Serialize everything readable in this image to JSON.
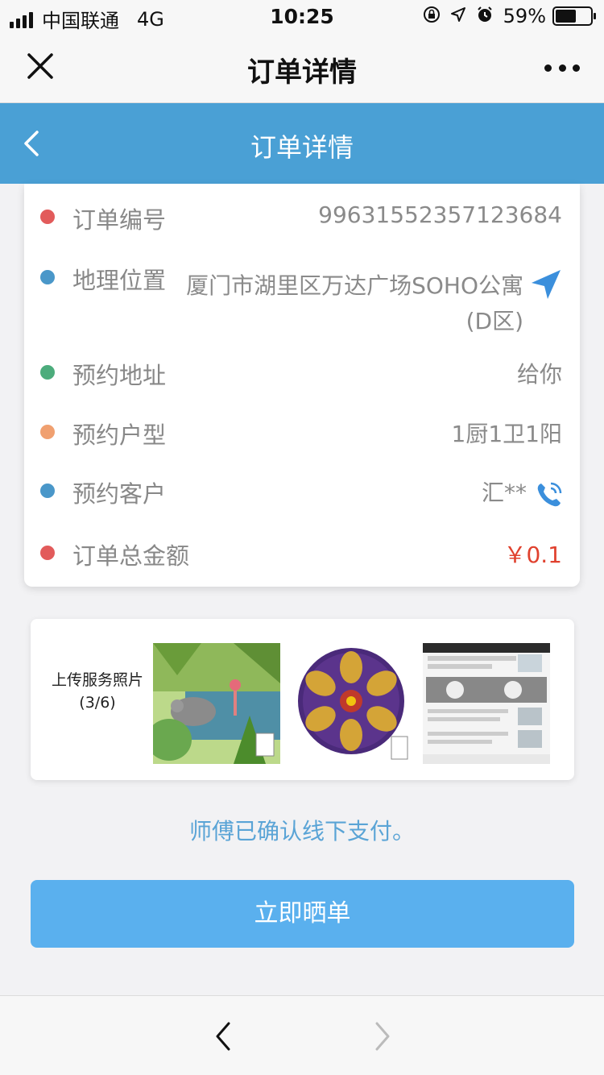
{
  "status_bar": {
    "carrier": "中国联通",
    "network": "4G",
    "time": "10:25",
    "battery": "59%",
    "battery_level": 0.59,
    "icons": [
      "orientation-lock-icon",
      "location-icon",
      "alarm-icon"
    ]
  },
  "wechat_header": {
    "title": "订单详情",
    "close_icon": "close-icon",
    "more_icon": "more-icon"
  },
  "app_nav": {
    "title": "订单详情",
    "back_icon": "chevron-left-icon"
  },
  "order": {
    "number": {
      "label": "订单编号",
      "value": "99631552357123684",
      "dot_color": "#e25b5b"
    },
    "location": {
      "label": "地理位置",
      "value": "厦门市湖里区万达广场SOHO公寓(D区)",
      "dot_color": "#4a97c9",
      "icon": "navigation-arrow-icon"
    },
    "address": {
      "label": "预约地址",
      "value": "给你",
      "dot_color": "#4cac7c"
    },
    "house_type": {
      "label": "预约户型",
      "value": "1厨1卫1阳",
      "dot_color": "#f0a070"
    },
    "customer": {
      "label": "预约客户",
      "value": "汇**",
      "dot_color": "#4a97c9",
      "icon": "phone-icon"
    },
    "total": {
      "label": "订单总金额",
      "value": "￥0.1",
      "dot_color": "#e25b5b",
      "value_color": "#e0412e"
    }
  },
  "photos": {
    "label": "上传服务照片",
    "count": "(3/6)",
    "items": [
      "jungle-illustration",
      "mandala-illustration",
      "chat-screenshot"
    ]
  },
  "confirm_text": "师傅已确认线下支付。",
  "primary_button": "立即晒单",
  "bottom_bar": {
    "back_icon": "chevron-left-icon",
    "forward_icon": "chevron-right-icon"
  },
  "colors": {
    "nav_blue": "#4aa0d5",
    "button_blue": "#5ab0ee",
    "confirm_blue": "#5aa4d6",
    "price_red": "#e0412e"
  }
}
